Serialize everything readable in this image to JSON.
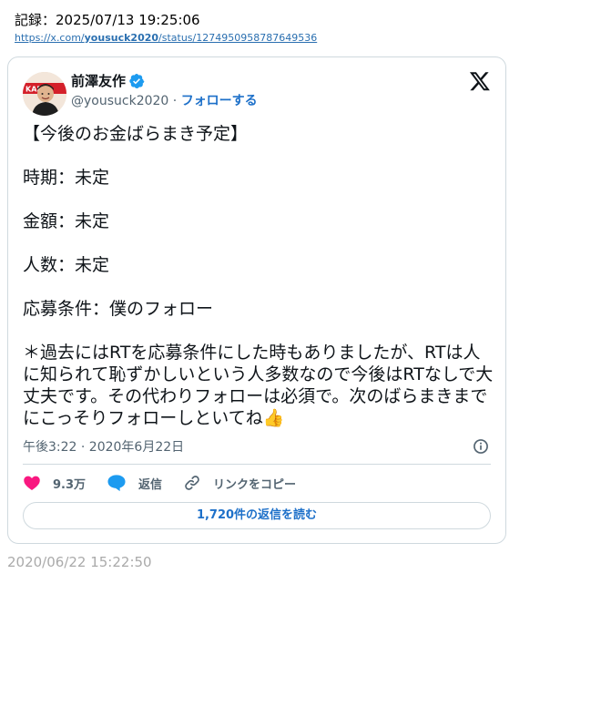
{
  "record": {
    "label": "記録：2025/07/13 19:25:06"
  },
  "url": {
    "prefix": "https://x.com/",
    "user": "yousuck2020",
    "suffix": "/status/1274950958787649536"
  },
  "tweet": {
    "author_name": "前澤友作",
    "handle": "@yousuck2020",
    "separator": " · ",
    "follow_label": "フォローする",
    "avatar_badge": "KABU",
    "text": "【今後のお金ばらまき予定】\n\n時期：未定\n\n金額：未定\n\n人数：未定\n\n応募条件：僕のフォロー\n\n＊過去にはRTを応募条件にした時もありましたが、RTは人に知られて恥ずかしいという人多数なので今後はRTなしで大丈夫です。その代わりフォローは必須で。次のばらまきまでにこっそりフォローしといてね👍",
    "timestamp": "午後3:22 · 2020年6月22日",
    "likes": "9.3万",
    "reply_label": "返信",
    "copy_link_label": "リンクをコピー",
    "read_replies_label": "1,720件の返信を読む"
  },
  "footer": {
    "archived_date": "2020/06/22 15:22:50"
  },
  "icons": {
    "verified": "verified-badge-icon",
    "x_logo": "x-logo-icon",
    "info": "info-icon",
    "heart": "heart-icon",
    "reply": "speech-bubble-icon",
    "link": "link-icon"
  },
  "colors": {
    "link_blue": "#1d70c9",
    "verified_blue": "#1d9bf0",
    "heart_pink": "#f91880",
    "url_blue": "#2a6fb0",
    "muted": "#536471",
    "border": "#cfd9de"
  }
}
